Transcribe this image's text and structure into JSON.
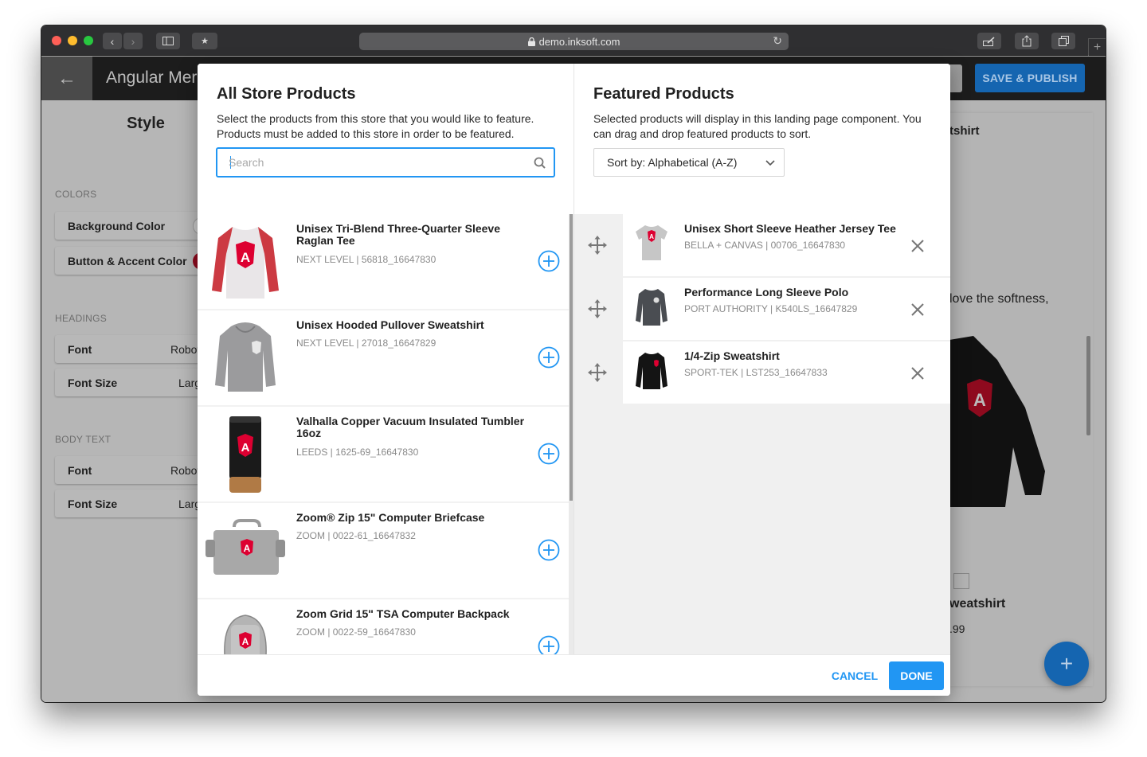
{
  "browser": {
    "url": "demo.inksoft.com",
    "icons": [
      "back-icon",
      "forward-icon",
      "sidebar-icon",
      "bookmark-icon",
      "lock-icon",
      "reload-icon",
      "markup-icon",
      "share-icon",
      "tabs-icon",
      "new-tab-icon"
    ]
  },
  "app": {
    "title": "Angular Merch",
    "save_publish_label": "SAVE & PUBLISH",
    "back_icon": "arrow-left-icon"
  },
  "style_panel": {
    "title": "Style",
    "sections": [
      {
        "label": "COLORS",
        "rows": [
          {
            "label": "Background Color",
            "swatch": "#ffffff"
          },
          {
            "label": "Button & Accent Color",
            "swatch": "#c3002f"
          }
        ]
      },
      {
        "label": "HEADINGS",
        "rows": [
          {
            "label": "Font",
            "value": "Roboto"
          },
          {
            "label": "Font Size",
            "value": "Large"
          }
        ]
      },
      {
        "label": "BODY TEXT",
        "rows": [
          {
            "label": "Font",
            "value": "Roboto"
          },
          {
            "label": "Font Size",
            "value": "Large"
          }
        ]
      }
    ]
  },
  "preview": {
    "heading_fragment": "tshirt",
    "body_fragment": "love the softness,",
    "product_name_fragment": "weatshirt",
    "price_fragment": ".99",
    "fab_icon": "plus-icon"
  },
  "modal": {
    "left": {
      "title": "All Store Products",
      "description": "Select the products from this store that you would like to feature. Products must be added to this store in order to be featured.",
      "search": {
        "placeholder": "Search",
        "value": ""
      },
      "products": [
        {
          "name": "Unisex Tri-Blend Three-Quarter Sleeve Raglan Tee",
          "sku": "NEXT LEVEL | 56818_16647830",
          "thumb": "raglan-tee"
        },
        {
          "name": "Unisex Hooded Pullover Sweatshirt",
          "sku": "NEXT LEVEL | 27018_16647829",
          "thumb": "hoodie"
        },
        {
          "name": "Valhalla Copper Vacuum Insulated Tumbler 16oz",
          "sku": "LEEDS | 1625-69_16647830",
          "thumb": "tumbler"
        },
        {
          "name": "Zoom® Zip 15\" Computer Briefcase",
          "sku": "ZOOM | 0022-61_16647832",
          "thumb": "briefcase"
        },
        {
          "name": "Zoom Grid 15\" TSA Computer Backpack",
          "sku": "ZOOM | 0022-59_16647830",
          "thumb": "backpack"
        }
      ]
    },
    "right": {
      "title": "Featured Products",
      "description": "Selected products will display in this landing page component. You can drag and drop featured products to sort.",
      "sort": {
        "selected": "Sort by: Alphabetical (A-Z)"
      },
      "featured": [
        {
          "name": "Unisex Short Sleeve Heather Jersey Tee",
          "sku": "BELLA + CANVAS | 00706_16647830",
          "thumb": "tee"
        },
        {
          "name": "Performance Long Sleeve Polo",
          "sku": "PORT AUTHORITY | K540LS_16647829",
          "thumb": "polo"
        },
        {
          "name": "1/4-Zip Sweatshirt",
          "sku": "SPORT-TEK | LST253_16647833",
          "thumb": "quarter-zip"
        }
      ]
    },
    "footer": {
      "cancel_label": "CANCEL",
      "done_label": "DONE"
    }
  },
  "colors": {
    "accent": "#2196f3",
    "brand_dark": "#1565b0",
    "angular_red": "#dd0031"
  }
}
